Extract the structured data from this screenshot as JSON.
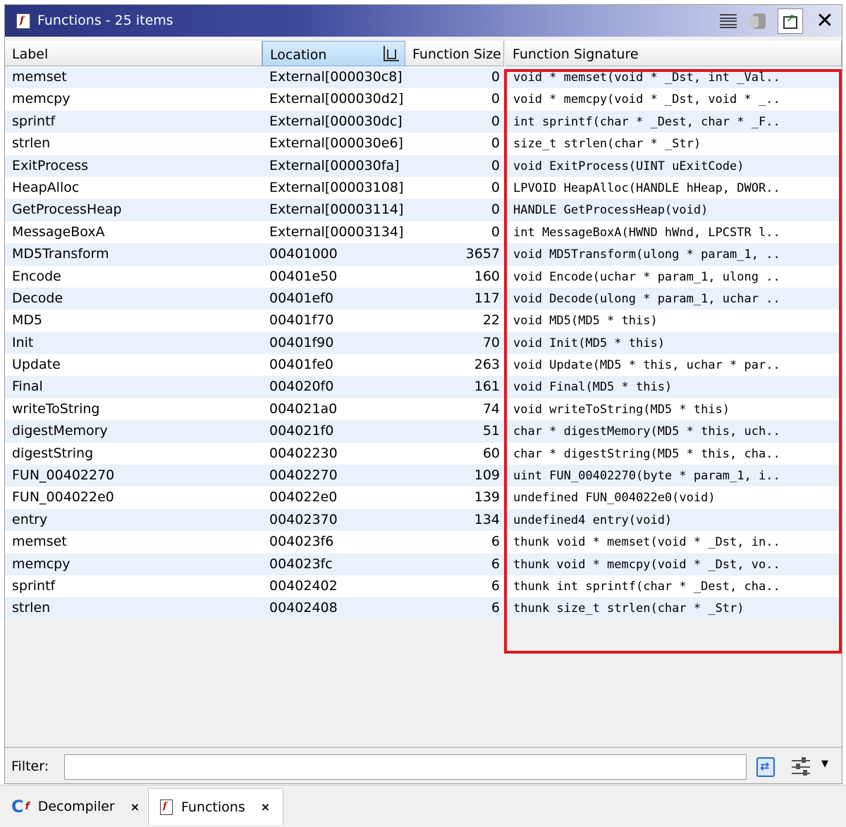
{
  "window": {
    "title": "Functions - 25 items"
  },
  "columns": {
    "label": "Label",
    "location": "Location",
    "size": "Function Size",
    "signature": "Function Signature"
  },
  "rows": [
    {
      "label": "memset",
      "location": "External[000030c8]",
      "size": "0",
      "signature": "void * memset(void * _Dst, int _Val.."
    },
    {
      "label": "memcpy",
      "location": "External[000030d2]",
      "size": "0",
      "signature": "void * memcpy(void * _Dst, void * _.."
    },
    {
      "label": "sprintf",
      "location": "External[000030dc]",
      "size": "0",
      "signature": "int sprintf(char * _Dest, char * _F.."
    },
    {
      "label": "strlen",
      "location": "External[000030e6]",
      "size": "0",
      "signature": "size_t strlen(char * _Str)"
    },
    {
      "label": "ExitProcess",
      "location": "External[000030fa]",
      "size": "0",
      "signature": "void ExitProcess(UINT uExitCode)"
    },
    {
      "label": "HeapAlloc",
      "location": "External[00003108]",
      "size": "0",
      "signature": "LPVOID HeapAlloc(HANDLE hHeap, DWOR.."
    },
    {
      "label": "GetProcessHeap",
      "location": "External[00003114]",
      "size": "0",
      "signature": "HANDLE GetProcessHeap(void)"
    },
    {
      "label": "MessageBoxA",
      "location": "External[00003134]",
      "size": "0",
      "signature": "int MessageBoxA(HWND hWnd, LPCSTR l.."
    },
    {
      "label": "MD5Transform",
      "location": "00401000",
      "size": "3657",
      "signature": "void MD5Transform(ulong * param_1, .."
    },
    {
      "label": "Encode",
      "location": "00401e50",
      "size": "160",
      "signature": "void Encode(uchar * param_1, ulong .."
    },
    {
      "label": "Decode",
      "location": "00401ef0",
      "size": "117",
      "signature": "void Decode(ulong * param_1, uchar .."
    },
    {
      "label": "MD5",
      "location": "00401f70",
      "size": "22",
      "signature": "void MD5(MD5 * this)"
    },
    {
      "label": "Init",
      "location": "00401f90",
      "size": "70",
      "signature": "void Init(MD5 * this)"
    },
    {
      "label": "Update",
      "location": "00401fe0",
      "size": "263",
      "signature": "void Update(MD5 * this, uchar * par.."
    },
    {
      "label": "Final",
      "location": "004020f0",
      "size": "161",
      "signature": "void Final(MD5 * this)"
    },
    {
      "label": "writeToString",
      "location": "004021a0",
      "size": "74",
      "signature": "void writeToString(MD5 * this)"
    },
    {
      "label": "digestMemory",
      "location": "004021f0",
      "size": "51",
      "signature": "char * digestMemory(MD5 * this, uch.."
    },
    {
      "label": "digestString",
      "location": "00402230",
      "size": "60",
      "signature": "char * digestString(MD5 * this, cha.."
    },
    {
      "label": "FUN_00402270",
      "location": "00402270",
      "size": "109",
      "signature": "uint FUN_00402270(byte * param_1, i.."
    },
    {
      "label": "FUN_004022e0",
      "location": "004022e0",
      "size": "139",
      "signature": "undefined FUN_004022e0(void)"
    },
    {
      "label": "entry",
      "location": "00402370",
      "size": "134",
      "signature": "undefined4 entry(void)"
    },
    {
      "label": "memset",
      "location": "004023f6",
      "size": "6",
      "signature": "thunk void * memset(void * _Dst, in.."
    },
    {
      "label": "memcpy",
      "location": "004023fc",
      "size": "6",
      "signature": "thunk void * memcpy(void * _Dst, vo.."
    },
    {
      "label": "sprintf",
      "location": "00402402",
      "size": "6",
      "signature": "thunk int sprintf(char * _Dest, cha.."
    },
    {
      "label": "strlen",
      "location": "00402408",
      "size": "6",
      "signature": "thunk size_t strlen(char * _Str)"
    }
  ],
  "filter": {
    "label": "Filter:",
    "value": ""
  },
  "tabs": [
    {
      "label": "Decompiler",
      "close": "×"
    },
    {
      "label": "Functions",
      "close": "×"
    }
  ],
  "colors": {
    "highlight": "#e0161e",
    "title_gradient_start": "#2b3480",
    "row_alt": "#e9f1fb"
  }
}
